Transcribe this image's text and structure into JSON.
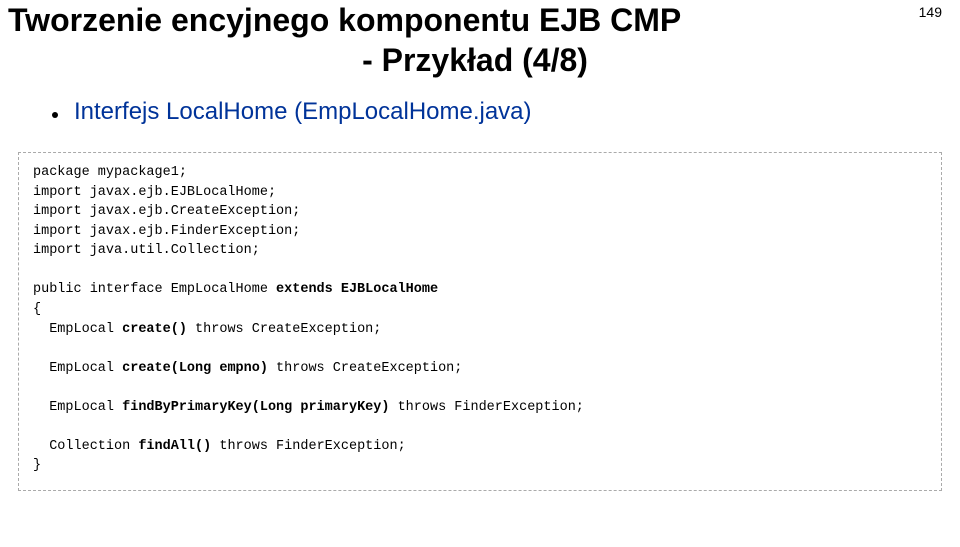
{
  "page_number": "149",
  "title": {
    "line1": "Tworzenie encyjnego komponentu EJB CMP",
    "line2": "- Przykład (4/8)"
  },
  "bullet": "Interfejs LocalHome (EmpLocalHome.java)",
  "code": {
    "l1": "package mypackage1;",
    "l2": "import javax.ejb.EJBLocalHome;",
    "l3": "import javax.ejb.CreateException;",
    "l4": "import javax.ejb.FinderException;",
    "l5": "import java.util.Collection;",
    "l6a": "public interface EmpLocalHome ",
    "l6b": "extends EJBLocalHome",
    "l7": "{",
    "l8a": "  EmpLocal ",
    "l8b": "create()",
    "l8c": " throws CreateException;",
    "l9a": "  EmpLocal ",
    "l9b": "create(Long empno)",
    "l9c": " throws CreateException;",
    "l10a": "  EmpLocal ",
    "l10b": "findByPrimaryKey(Long primaryKey)",
    "l10c": " throws FinderException;",
    "l11a": "  Collection ",
    "l11b": "findAll()",
    "l11c": " throws FinderException;",
    "l12": "}"
  }
}
